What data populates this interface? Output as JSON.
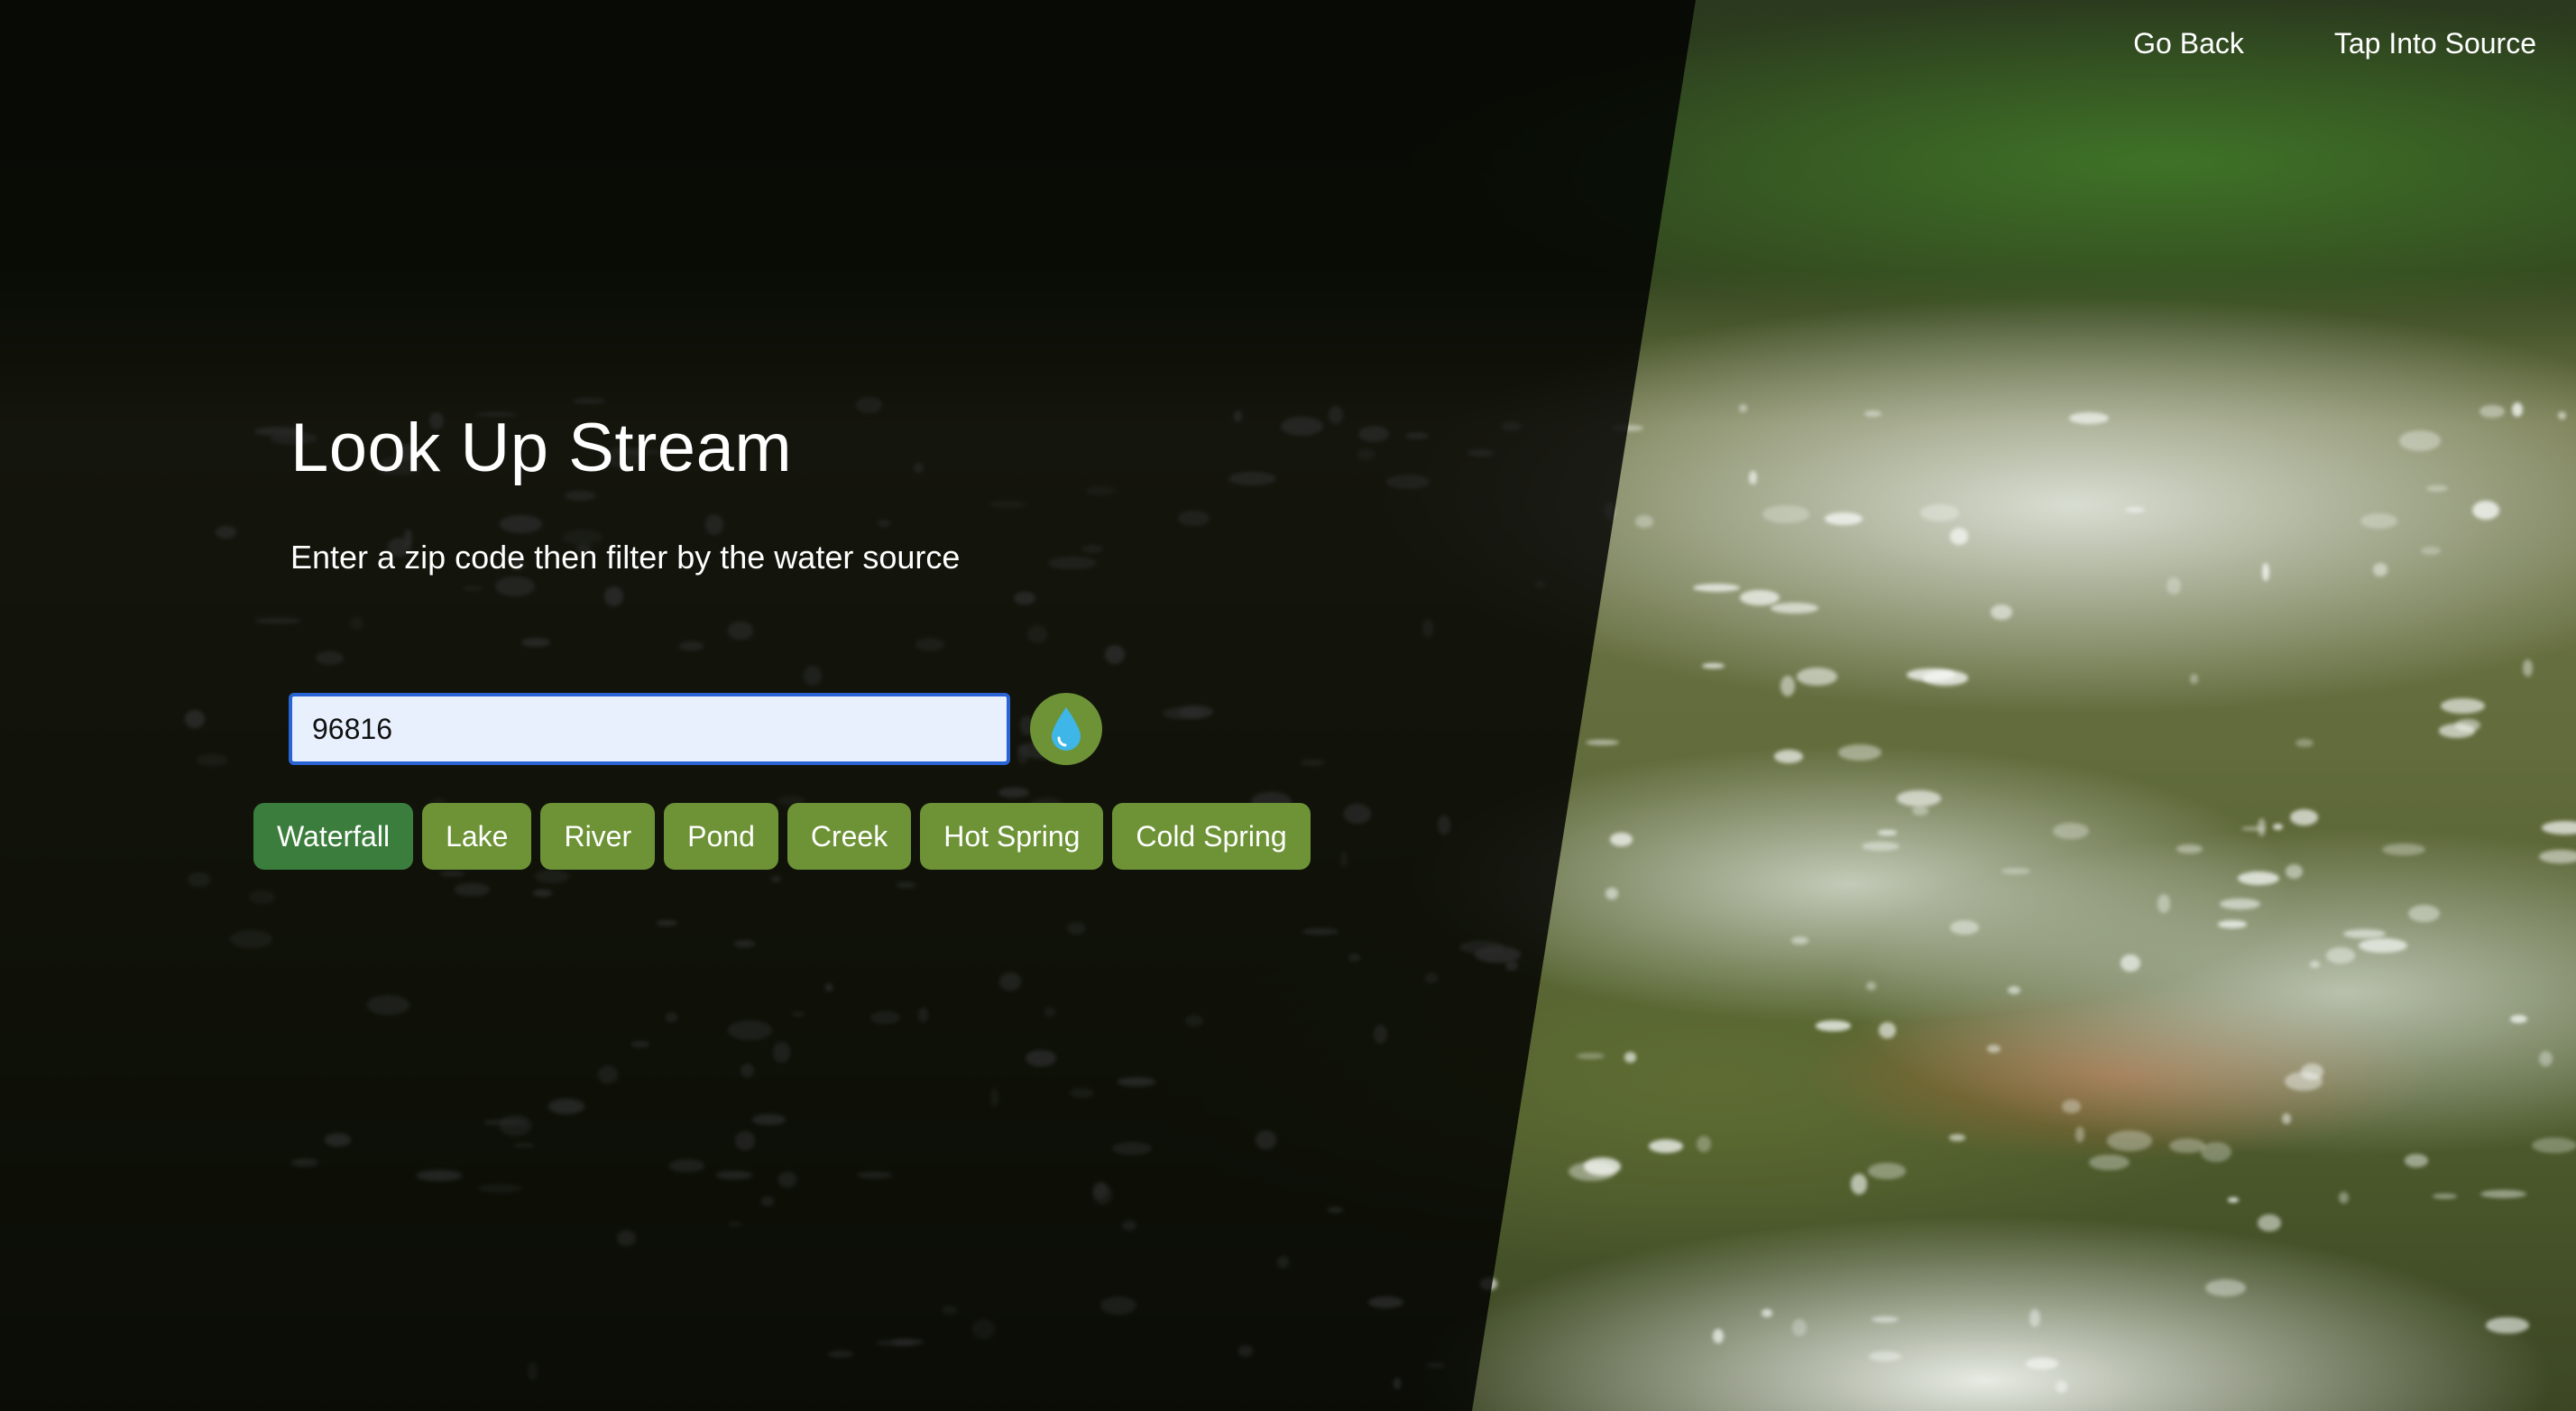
{
  "nav": {
    "items": [
      {
        "label": "Go Back"
      },
      {
        "label": "Tap Into Source"
      }
    ]
  },
  "hero": {
    "title": "Look Up Stream",
    "subtitle": "Enter a zip code then filter by the water source"
  },
  "search": {
    "zip_value": "96816",
    "submit_icon": "water-drop-icon"
  },
  "filters": {
    "items": [
      {
        "label": "Waterfall",
        "active": true
      },
      {
        "label": "Lake",
        "active": false
      },
      {
        "label": "River",
        "active": false
      },
      {
        "label": "Pond",
        "active": false
      },
      {
        "label": "Creek",
        "active": false
      },
      {
        "label": "Hot Spring",
        "active": false
      },
      {
        "label": "Cold Spring",
        "active": false
      }
    ]
  },
  "colors": {
    "button_green": "#6d9336",
    "active_green": "#3b7d3c",
    "input_focus_border": "#2a63d4",
    "drop_blue": "#3fb6e8"
  }
}
